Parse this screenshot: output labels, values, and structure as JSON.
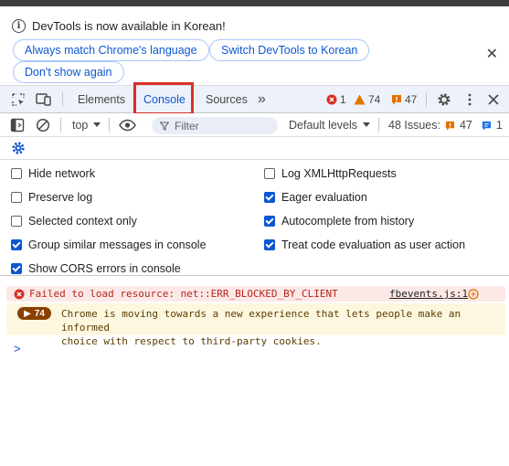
{
  "infobar": {
    "message": "DevTools is now available in Korean!",
    "buttons": {
      "match_language": "Always match Chrome's language",
      "switch_korean": "Switch DevTools to Korean",
      "dont_show": "Don't show again"
    },
    "close_glyph": "✕"
  },
  "tabs": {
    "elements": "Elements",
    "console": "Console",
    "sources": "Sources",
    "more_glyph": "»"
  },
  "counters": {
    "errors": "1",
    "warnings": "74",
    "issues": "47"
  },
  "toolbar": {
    "context": "top",
    "filter_placeholder": "Filter",
    "levels": "Default levels",
    "issues_label": "48 Issues:",
    "issues_warn": "47",
    "issues_info": "1"
  },
  "settings": {
    "left": [
      {
        "label": "Hide network",
        "checked": false
      },
      {
        "label": "Preserve log",
        "checked": false
      },
      {
        "label": "Selected context only",
        "checked": false
      },
      {
        "label": "Group similar messages in console",
        "checked": true
      },
      {
        "label": "Show CORS errors in console",
        "checked": true
      }
    ],
    "right": [
      {
        "label": "Log XMLHttpRequests",
        "checked": false
      },
      {
        "label": "Eager evaluation",
        "checked": true
      },
      {
        "label": "Autocomplete from history",
        "checked": true
      },
      {
        "label": "Treat code evaluation as user action",
        "checked": true
      }
    ]
  },
  "messages": {
    "error": {
      "text": "Failed to load resource: net::ERR_BLOCKED_BY_CLIENT",
      "source": "fbevents.js:1"
    },
    "warning": {
      "count": "74",
      "line1": "Chrome is moving towards a new experience that lets people make an informed",
      "line2": "choice with respect to third-party cookies."
    },
    "prompt_glyph": ">"
  },
  "colors": {
    "accent": "#0b57d0",
    "error": "#d93025",
    "warning": "#e37400",
    "highlight_outline": "#d93025"
  }
}
